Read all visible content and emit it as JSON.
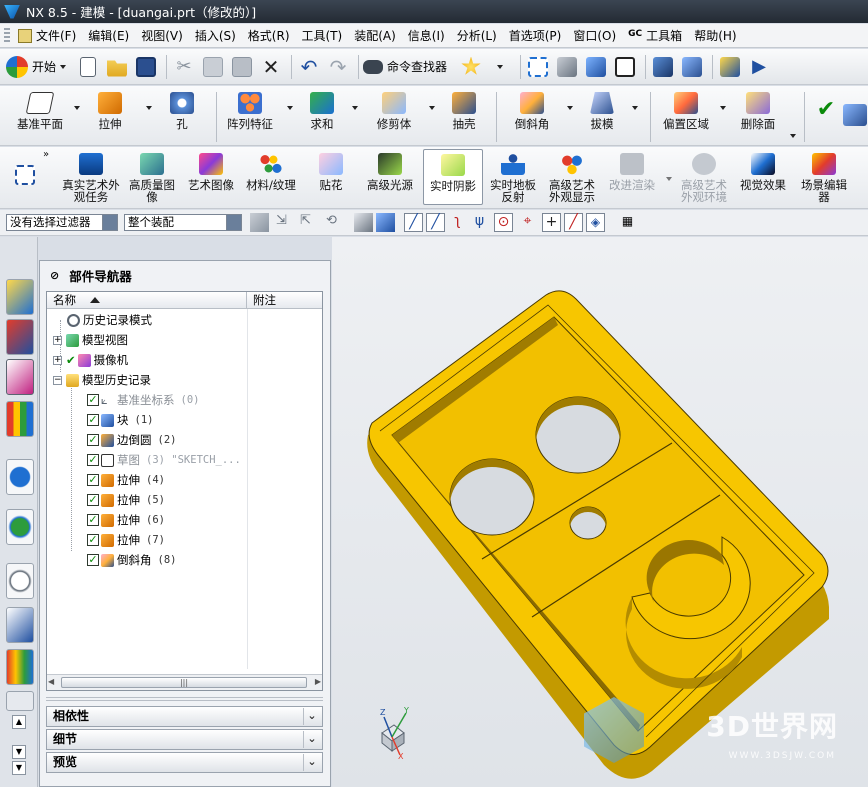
{
  "window": {
    "title": "NX 8.5 - 建模 - [duangai.prt（修改的）]"
  },
  "menu": [
    "文件(F)",
    "编辑(E)",
    "视图(V)",
    "插入(S)",
    "格式(R)",
    "工具(T)",
    "装配(A)",
    "信息(I)",
    "分析(L)",
    "首选项(P)",
    "窗口(O)",
    "工具箱",
    "帮助(H)"
  ],
  "toolbar1": {
    "start_label": "开始",
    "finder_label": "命令查找器"
  },
  "toolbar2": [
    "基准平面",
    "拉伸",
    "孔",
    "阵列特征",
    "求和",
    "修剪体",
    "抽壳",
    "倒斜角",
    "拔模",
    "偏置区域",
    "删除面"
  ],
  "toolbar3": [
    "真实艺术外观任务",
    "高质量图像",
    "艺术图像",
    "材料/纹理",
    "贴花",
    "高级光源",
    "实时阴影",
    "实时地板反射",
    "高级艺术外观显示",
    "改进渲染",
    "高级艺术外观环境",
    "视觉效果",
    "场景编辑器"
  ],
  "filter": {
    "selection_filter": "没有选择过滤器",
    "assembly_scope": "整个装配"
  },
  "navigator": {
    "title": "部件导航器",
    "col_name": "名称",
    "col_note": "附注",
    "items": [
      {
        "label": "历史记录模式",
        "num": ""
      },
      {
        "label": "模型视图",
        "num": ""
      },
      {
        "label": "摄像机",
        "num": ""
      },
      {
        "label": "模型历史记录",
        "num": ""
      },
      {
        "label": "基准坐标系",
        "num": "(0)"
      },
      {
        "label": "块",
        "num": "(1)"
      },
      {
        "label": "边倒圆",
        "num": "(2)"
      },
      {
        "label": "草图",
        "num": "(3) \"SKETCH_..."
      },
      {
        "label": "拉伸",
        "num": "(4)"
      },
      {
        "label": "拉伸",
        "num": "(5)"
      },
      {
        "label": "拉伸",
        "num": "(6)"
      },
      {
        "label": "拉伸",
        "num": "(7)"
      },
      {
        "label": "倒斜角",
        "num": "(8)"
      }
    ],
    "panels": [
      "相依性",
      "细节",
      "预览"
    ]
  },
  "watermark": {
    "main": "3D世界网",
    "sub": "WWW.3DSJW.COM"
  },
  "colors": {
    "part": "#f7c600",
    "part_dark": "#c39a00",
    "accent": "#0a8a0a"
  }
}
